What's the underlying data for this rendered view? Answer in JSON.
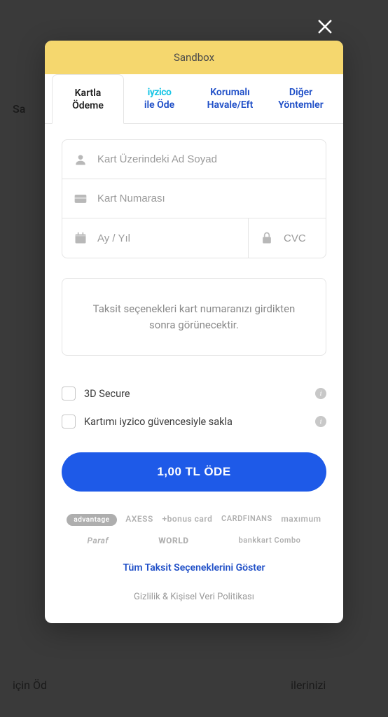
{
  "background": {
    "partial_left": "Sa",
    "partial_bottom_left": "için Öd",
    "partial_bottom_right": "ilerinizi"
  },
  "header": {
    "title": "Sandbox"
  },
  "tabs": [
    {
      "line1": "Kartla",
      "line2": "Ödeme",
      "active": true
    },
    {
      "line1": "iyzico",
      "line2": "ile Öde",
      "brand": true
    },
    {
      "line1": "Korumalı",
      "line2": "Havale/Eft"
    },
    {
      "line1": "Diğer",
      "line2": "Yöntemler"
    }
  ],
  "fields": {
    "name_placeholder": "Kart Üzerindeki Ad Soyad",
    "number_placeholder": "Kart Numarası",
    "expiry_placeholder": "Ay / Yıl",
    "cvc_placeholder": "CVC"
  },
  "info_box": "Taksit seçenekleri kart numaranızı girdikten sonra görünecektir.",
  "checks": {
    "secure3d": "3D Secure",
    "save_card": "Kartımı iyzico güvencesiyle sakla"
  },
  "pay_button": "1,00 TL ÖDE",
  "logos": [
    "advantage",
    "AXESS",
    "+bonus card",
    "CARDFINANS",
    "maxımum",
    "Paraf",
    "WORLD",
    "bankkart Combo"
  ],
  "show_all": "Tüm Taksit Seçeneklerini Göster",
  "privacy": "Gizlilik & Kişisel Veri Politikası"
}
